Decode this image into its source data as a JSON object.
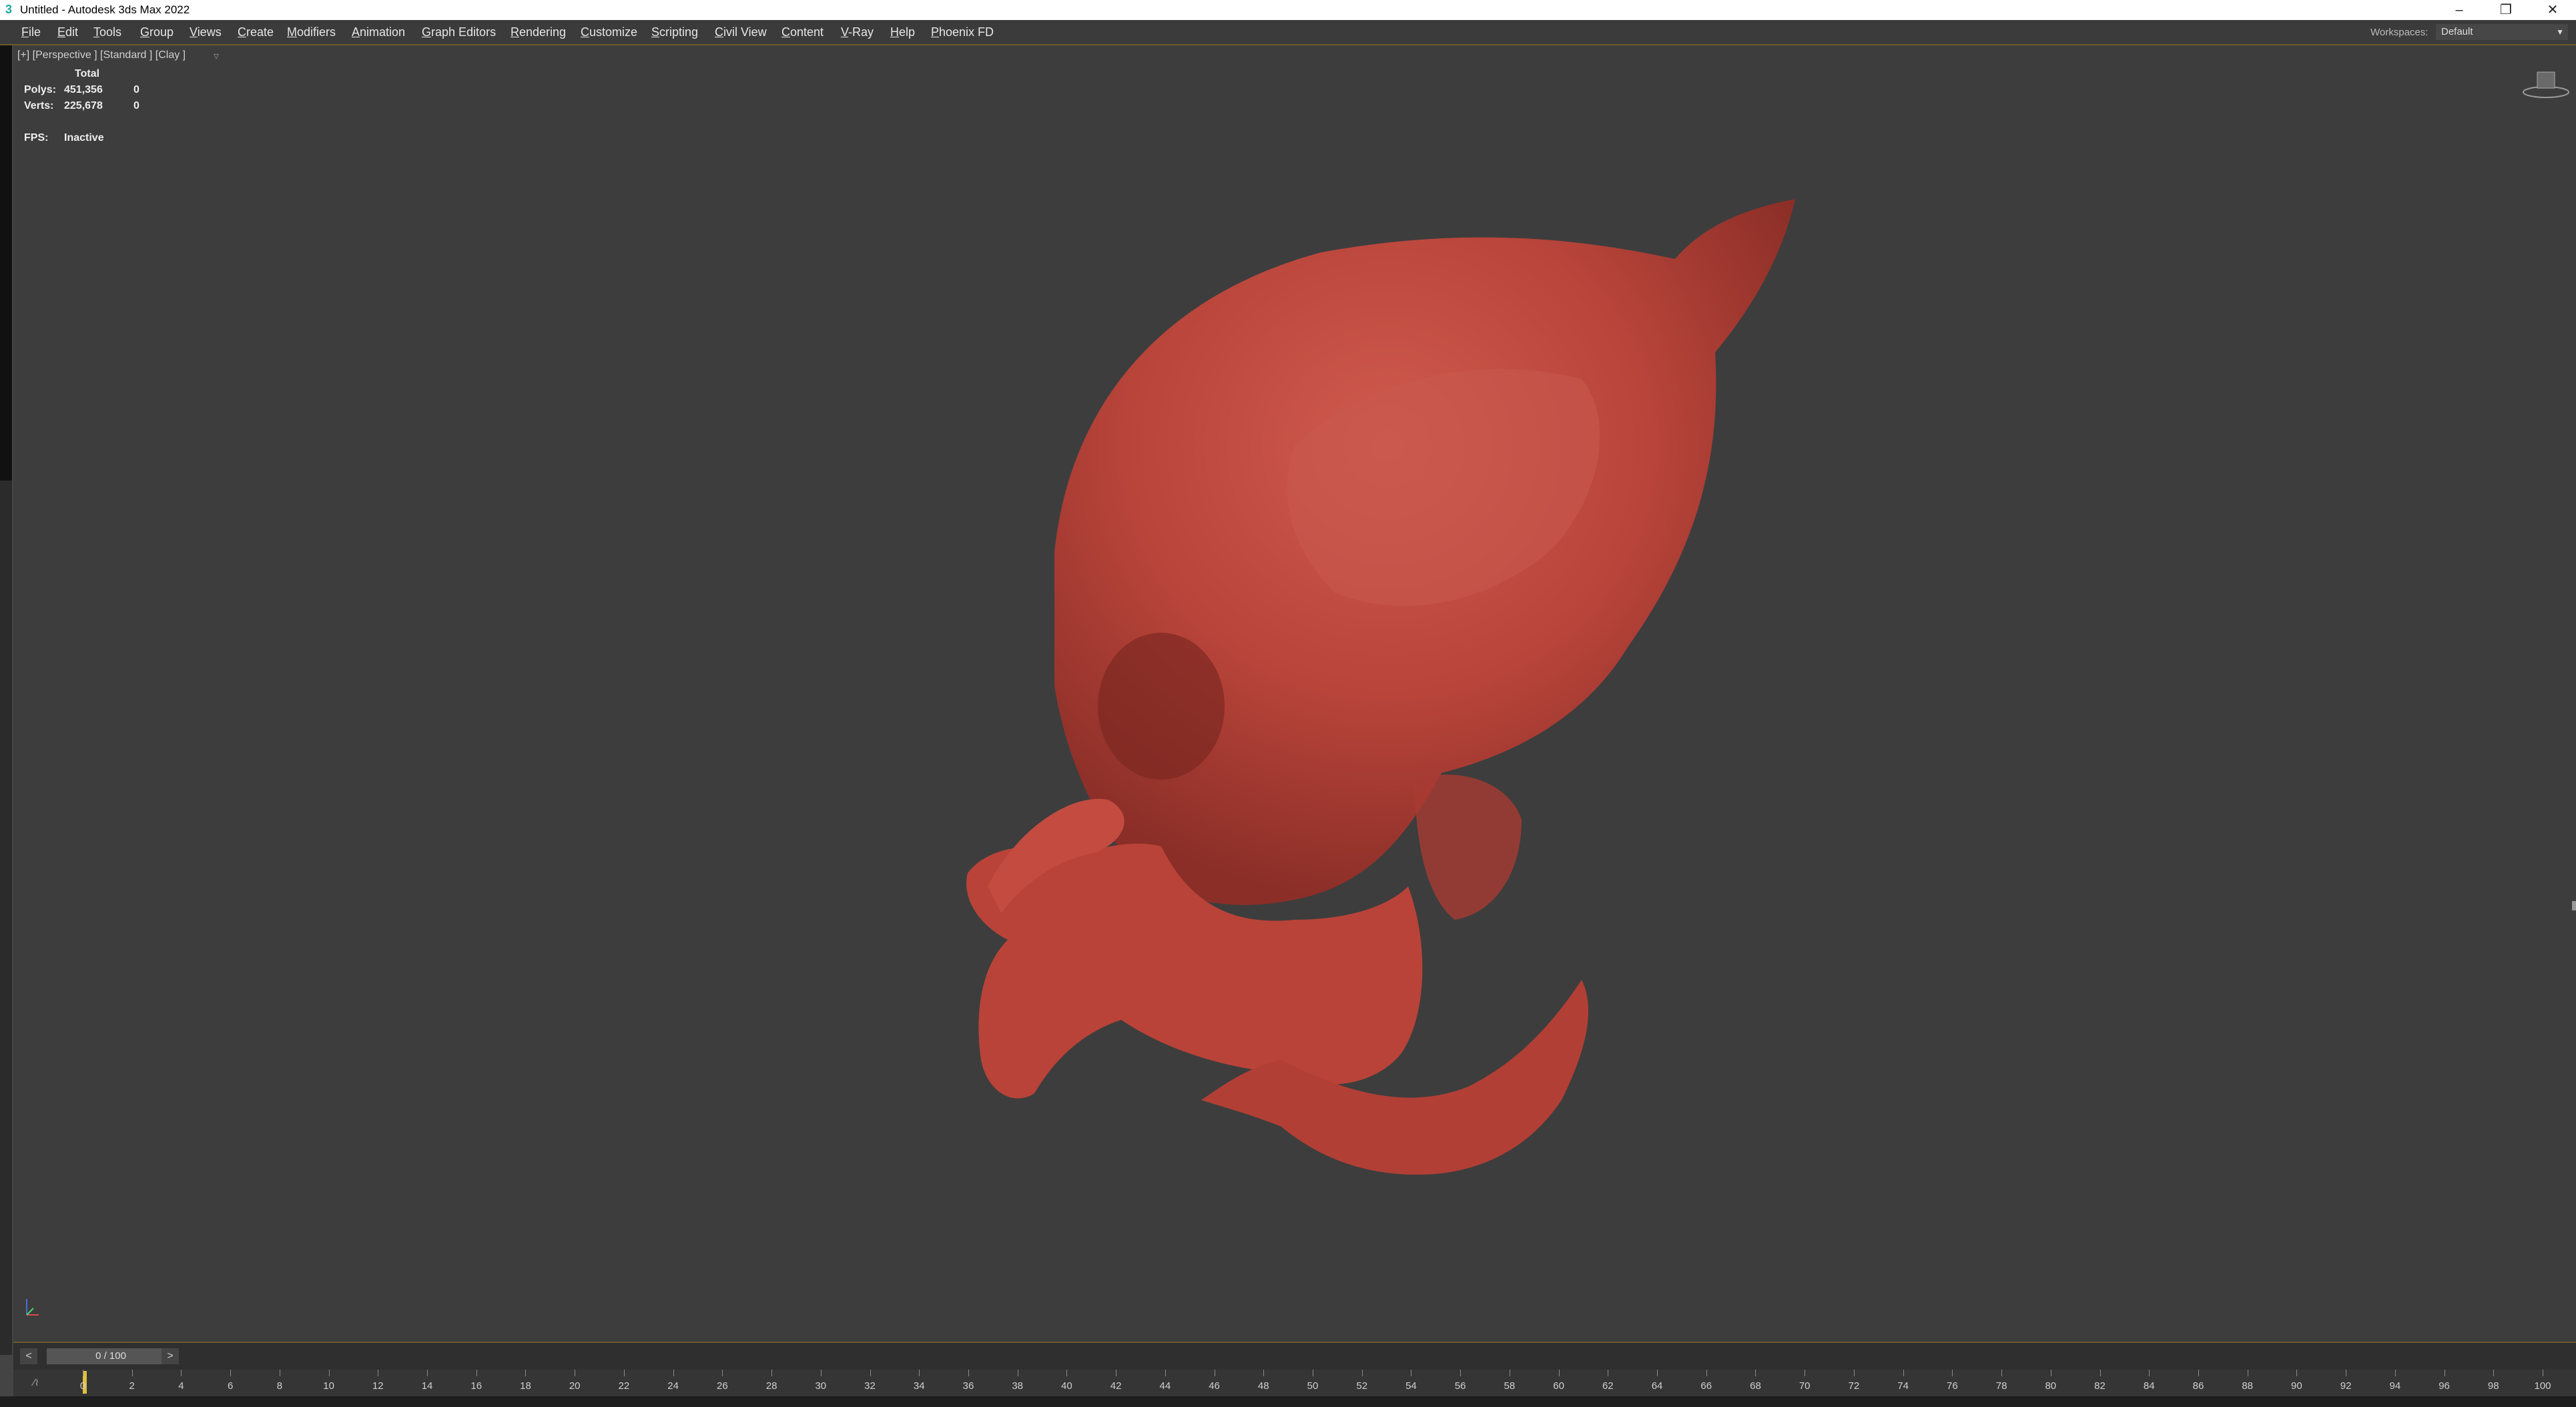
{
  "window": {
    "title": "Untitled - Autodesk 3ds Max 2022",
    "app_icon": "3ds-max-icon",
    "controls": [
      "minimize",
      "restore",
      "close"
    ]
  },
  "menubar": {
    "items": [
      "File",
      "Edit",
      "Tools",
      "Group",
      "Views",
      "Create",
      "Modifiers",
      "Animation",
      "Graph Editors",
      "Rendering",
      "Customize",
      "Scripting",
      "Civil View",
      "Content",
      "V-Ray",
      "Help",
      "Phoenix FD"
    ],
    "workspace_label": "Workspaces:",
    "workspace_value": "Default"
  },
  "viewport": {
    "label": "[+] [Perspective ] [Standard ] [Clay ]",
    "stats": {
      "header": "Total",
      "polys_label": "Polys:",
      "polys_total": "451,356",
      "polys_selected": "0",
      "verts_label": "Verts:",
      "verts_total": "225,678",
      "verts_selected": "0",
      "fps_label": "FPS:",
      "fps_value": "Inactive"
    },
    "model_color": "#c8463c"
  },
  "timeslider": {
    "prev": "<",
    "next": ">",
    "value": "0 / 100"
  },
  "timeline": {
    "ticks": [
      "0",
      "2",
      "4",
      "6",
      "8",
      "10",
      "12",
      "14",
      "16",
      "18",
      "20",
      "22",
      "24",
      "26",
      "28",
      "30",
      "32",
      "34",
      "36",
      "38",
      "40",
      "42",
      "44",
      "46",
      "48",
      "50",
      "52",
      "54",
      "56",
      "58",
      "60",
      "62",
      "64",
      "66",
      "68",
      "70",
      "72",
      "74",
      "76",
      "78",
      "80",
      "82",
      "84",
      "86",
      "88",
      "90",
      "92",
      "94",
      "96",
      "98",
      "100"
    ]
  }
}
